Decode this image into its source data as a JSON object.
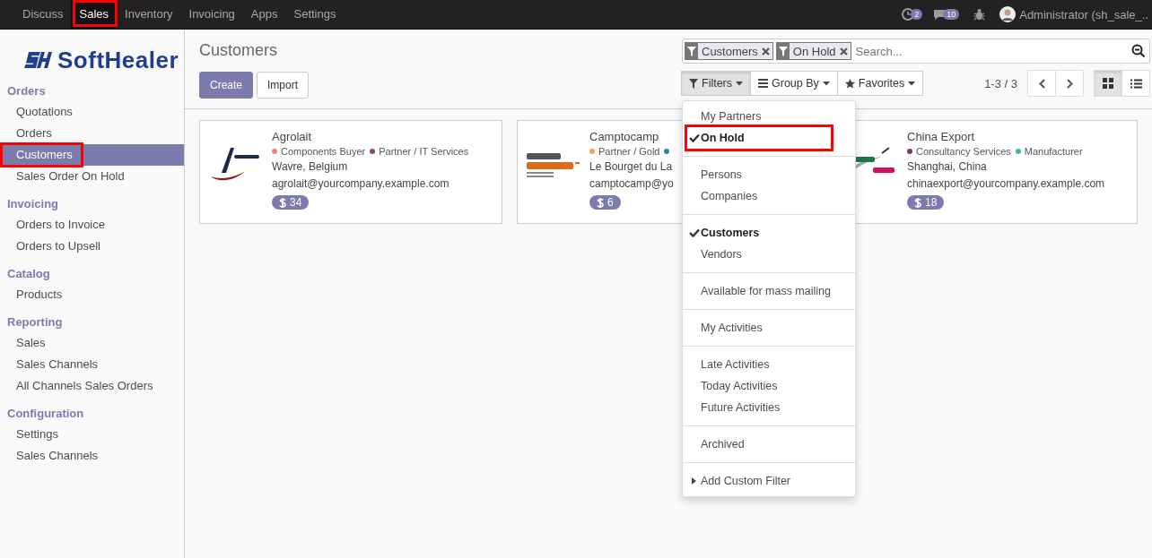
{
  "top_menu": [
    {
      "label": "Discuss",
      "selected": false,
      "highlighted": false
    },
    {
      "label": "Sales",
      "selected": true,
      "highlighted": true
    },
    {
      "label": "Inventory",
      "selected": false,
      "highlighted": false
    },
    {
      "label": "Invoicing",
      "selected": false,
      "highlighted": false
    },
    {
      "label": "Apps",
      "selected": false,
      "highlighted": false
    },
    {
      "label": "Settings",
      "selected": false,
      "highlighted": false
    }
  ],
  "systray": {
    "activity_count": "2",
    "message_count": "10",
    "user": "Administrator (sh_sale_.."
  },
  "logo": {
    "text": "SoftHealer"
  },
  "sidebar": [
    {
      "title": "Orders",
      "items": [
        {
          "label": "Quotations",
          "selected": false,
          "highlighted": false
        },
        {
          "label": "Orders",
          "selected": false,
          "highlighted": false
        },
        {
          "label": "Customers",
          "selected": true,
          "highlighted": true
        },
        {
          "label": "Sales Order On Hold",
          "selected": false,
          "highlighted": false
        }
      ]
    },
    {
      "title": "Invoicing",
      "items": [
        {
          "label": "Orders to Invoice",
          "selected": false,
          "highlighted": false
        },
        {
          "label": "Orders to Upsell",
          "selected": false,
          "highlighted": false
        }
      ]
    },
    {
      "title": "Catalog",
      "items": [
        {
          "label": "Products",
          "selected": false,
          "highlighted": false
        }
      ]
    },
    {
      "title": "Reporting",
      "items": [
        {
          "label": "Sales",
          "selected": false,
          "highlighted": false
        },
        {
          "label": "Sales Channels",
          "selected": false,
          "highlighted": false
        },
        {
          "label": "All Channels Sales Orders",
          "selected": false,
          "highlighted": false
        }
      ]
    },
    {
      "title": "Configuration",
      "items": [
        {
          "label": "Settings",
          "selected": false,
          "highlighted": false
        },
        {
          "label": "Sales Channels",
          "selected": false,
          "highlighted": false
        }
      ]
    }
  ],
  "page_title": "Customers",
  "buttons": {
    "create": "Create",
    "import": "Import"
  },
  "search": {
    "facets": [
      "Customers",
      "On Hold"
    ],
    "placeholder": "Search..."
  },
  "search_menus": [
    {
      "label": "Filters",
      "selected": true
    },
    {
      "label": "Group By",
      "selected": false
    },
    {
      "label": "Favorites",
      "selected": false
    }
  ],
  "pager": "1-3 / 3",
  "views": [
    {
      "selected": true
    },
    {
      "selected": false
    }
  ],
  "filters_menu": [
    [
      {
        "label": "My Partners",
        "checked": false,
        "highlighted": false
      },
      {
        "label": "On Hold",
        "checked": true,
        "highlighted": true
      }
    ],
    [
      {
        "label": "Persons",
        "checked": false,
        "highlighted": false
      },
      {
        "label": "Companies",
        "checked": false,
        "highlighted": false
      }
    ],
    [
      {
        "label": "Customers",
        "checked": true,
        "highlighted": false
      },
      {
        "label": "Vendors",
        "checked": false,
        "highlighted": false
      }
    ],
    [
      {
        "label": "Available for mass mailing",
        "checked": false,
        "highlighted": false
      }
    ],
    [
      {
        "label": "My Activities",
        "checked": false,
        "highlighted": false
      }
    ],
    [
      {
        "label": "Late Activities",
        "checked": false,
        "highlighted": false
      },
      {
        "label": "Today Activities",
        "checked": false,
        "highlighted": false
      },
      {
        "label": "Future Activities",
        "checked": false,
        "highlighted": false
      }
    ],
    [
      {
        "label": "Archived",
        "checked": false,
        "highlighted": false
      }
    ],
    [
      {
        "label": "Add Custom Filter",
        "checked": false,
        "highlighted": false,
        "kind": "expander"
      }
    ]
  ],
  "cards": [
    {
      "name": "Agrolait",
      "tags": [
        {
          "label": "Components Buyer",
          "color": "#f08080"
        },
        {
          "label": "Partner / IT Services",
          "color": "#8a4a6a"
        }
      ],
      "city": "Wavre, Belgium",
      "email": "agrolait@yourcompany.example.com",
      "sales": "34"
    },
    {
      "name": "Camptocamp",
      "tags": [
        {
          "label": "Partner / Gold",
          "color": "#f4a460"
        },
        {
          "color": "#2a8a9a"
        }
      ],
      "city": "Le Bourget du La",
      "email": "camptocamp@yo",
      "sales": "6"
    },
    {
      "name": "China Export",
      "tags": [
        {
          "label": "Consultancy Services",
          "color": "#7c3c5c"
        },
        {
          "label": "Manufacturer",
          "color": "#3cbf7f"
        }
      ],
      "city": "Shanghai, China",
      "email": "chinaexport@yourcompany.example.com",
      "sales": "18"
    }
  ]
}
